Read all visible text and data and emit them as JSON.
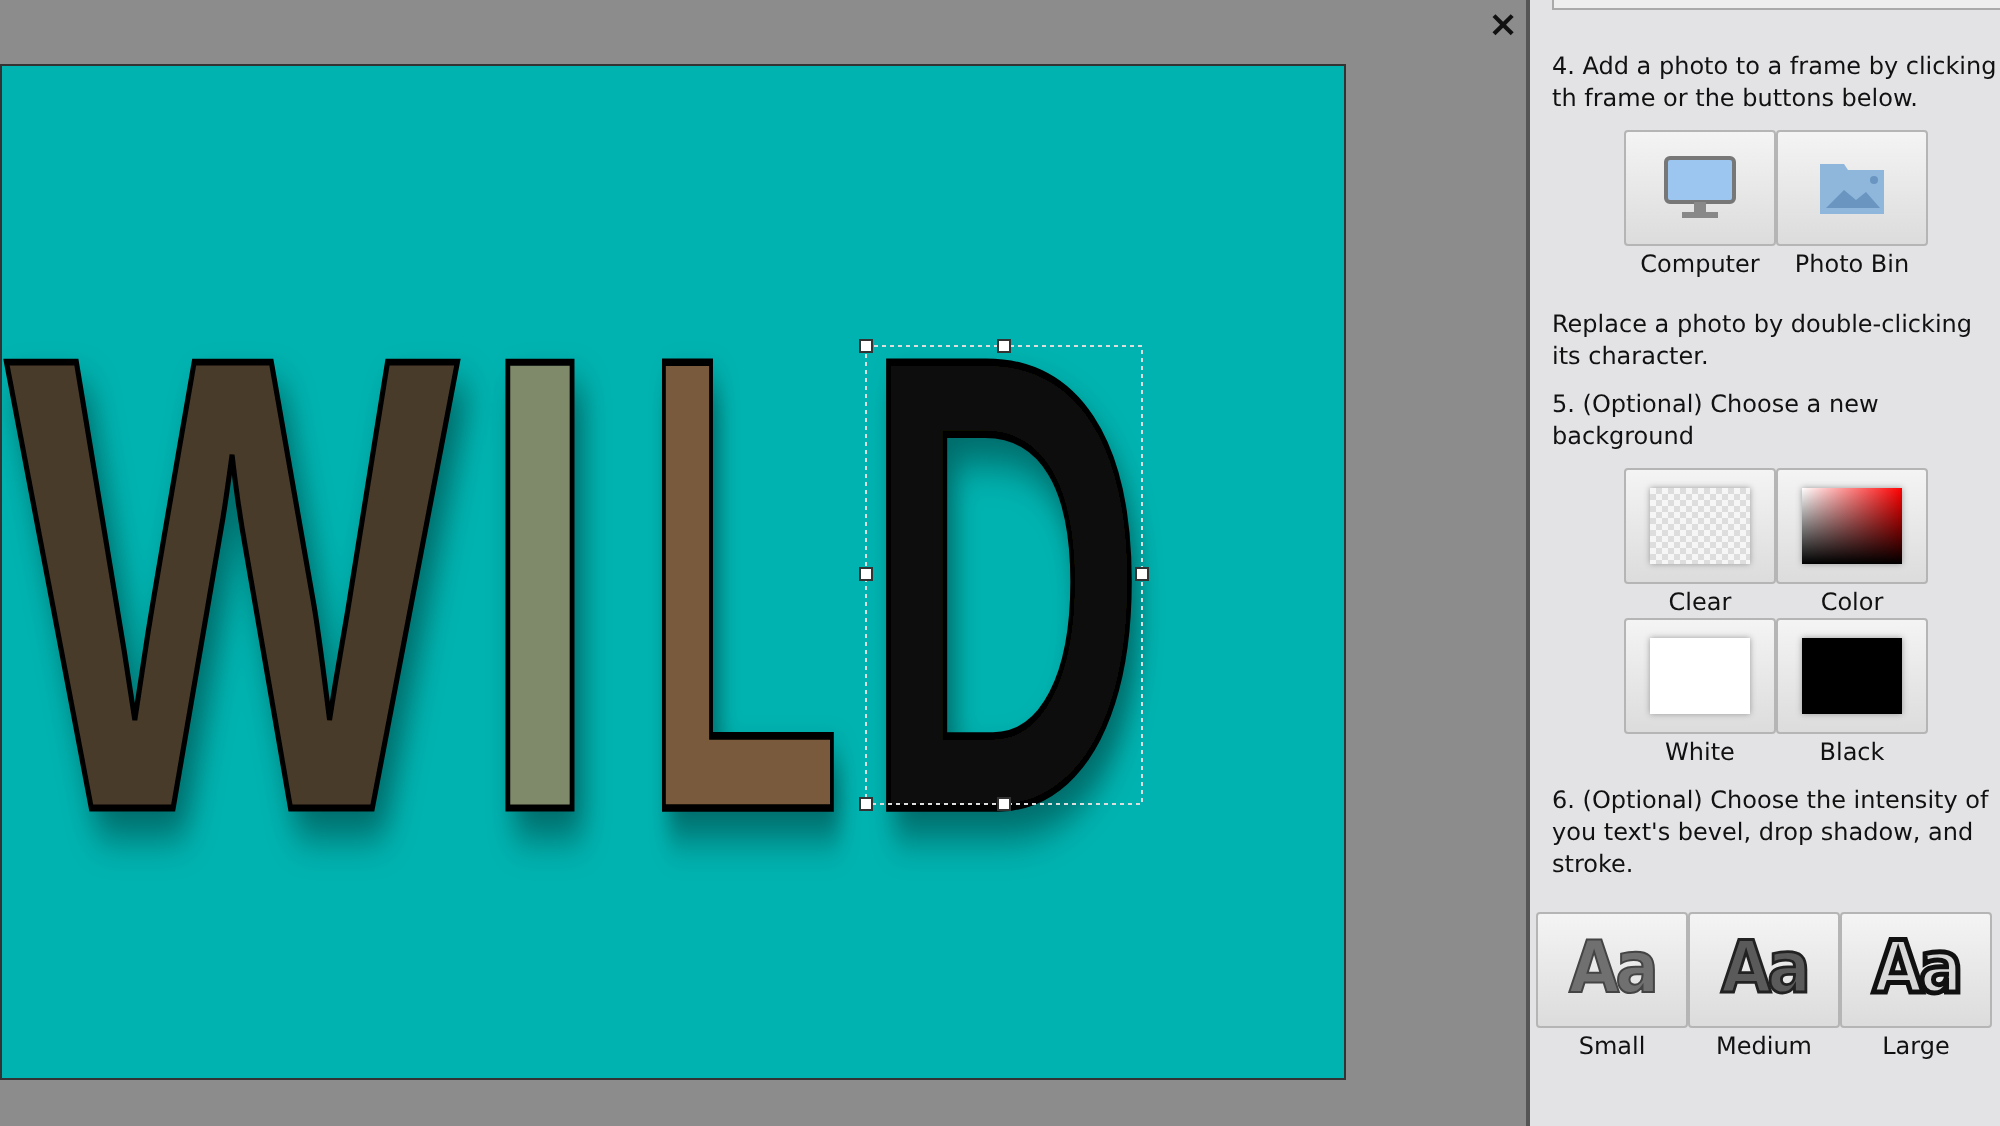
{
  "canvas": {
    "close_icon": "×",
    "letters": [
      {
        "char": "W",
        "color": "#4a3b2c"
      },
      {
        "char": "I",
        "color": "#7f8a6a"
      },
      {
        "char": "L",
        "color": "#7a5a3c"
      },
      {
        "char": "D",
        "color": "#0c0b08"
      }
    ]
  },
  "panel": {
    "step4": "4. Add a photo to a frame by clicking th frame or the buttons below.",
    "photo_sources": [
      {
        "kind": "computer",
        "label": "Computer"
      },
      {
        "kind": "bin",
        "label": "Photo Bin"
      }
    ],
    "replace_note": "Replace a photo by double-clicking its character.",
    "step5": "5. (Optional) Choose a new background",
    "backgrounds": [
      {
        "kind": "clear",
        "label": "Clear"
      },
      {
        "kind": "color",
        "label": "Color"
      },
      {
        "kind": "white",
        "label": "White"
      },
      {
        "kind": "black",
        "label": "Black"
      }
    ],
    "step6": "6. (Optional) Choose the intensity of you text's bevel, drop shadow, and stroke.",
    "intensities": [
      {
        "kind": "small",
        "glyph": "Aa",
        "label": "Small"
      },
      {
        "kind": "medium",
        "glyph": "Aa",
        "label": "Medium"
      },
      {
        "kind": "large",
        "glyph": "Aa",
        "label": "Large"
      }
    ]
  }
}
